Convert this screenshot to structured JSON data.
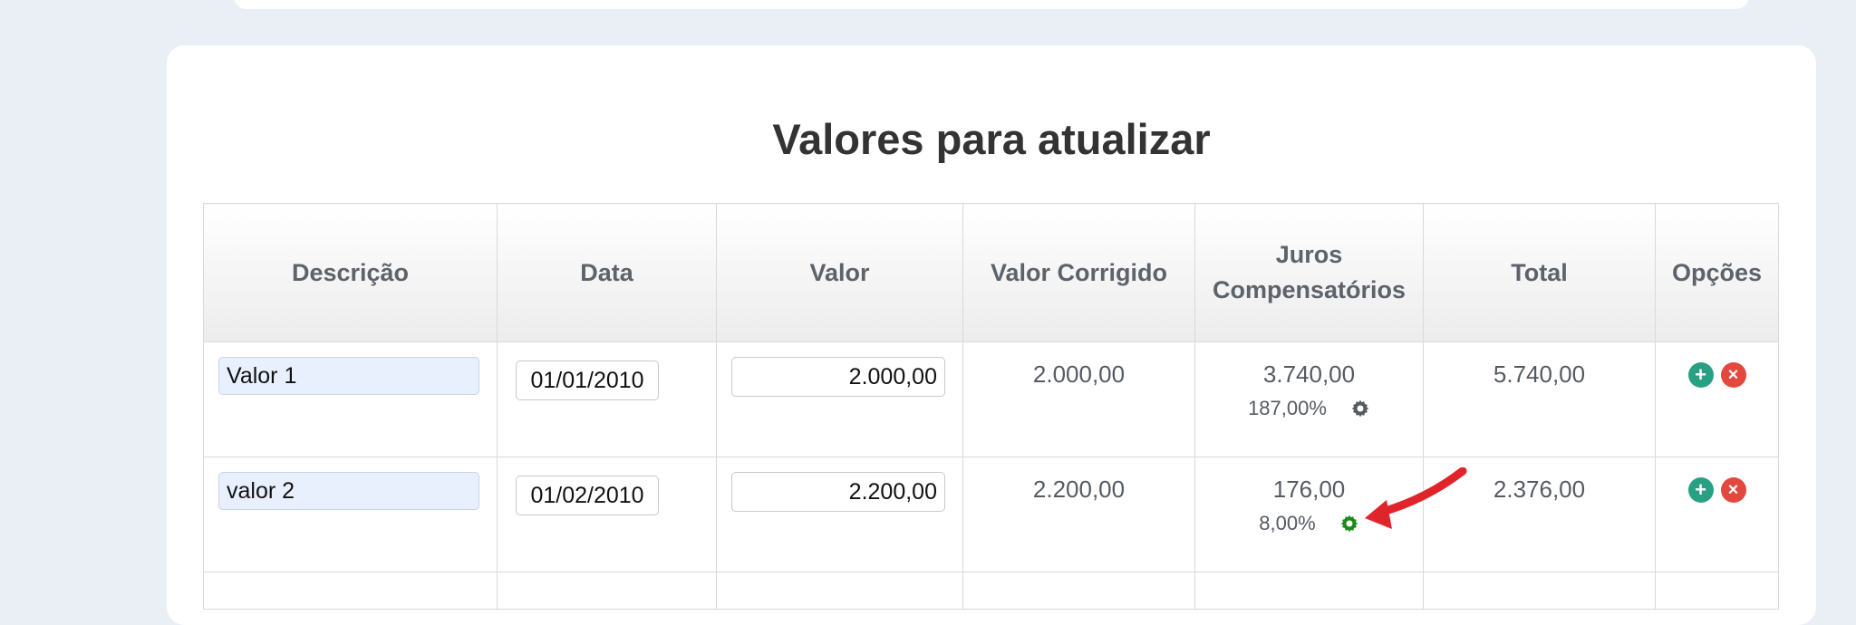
{
  "title": "Valores para atualizar",
  "columns": {
    "descricao": "Descrição",
    "data": "Data",
    "valor": "Valor",
    "valor_corrigido": "Valor Corrigido",
    "juros_line1": "Juros",
    "juros_line2": "Compensatórios",
    "total": "Total",
    "opcoes": "Opções"
  },
  "rows": [
    {
      "descricao": "Valor 1",
      "data": "01/01/2010",
      "valor": "2.000,00",
      "valor_corrigido": "2.000,00",
      "juros": "3.740,00",
      "juros_percent": "187,00%",
      "gear_color": "#555b63",
      "total": "5.740,00",
      "add_icon": "+",
      "remove_icon": "×"
    },
    {
      "descricao": "valor 2",
      "data": "01/02/2010",
      "valor": "2.200,00",
      "valor_corrigido": "2.200,00",
      "juros": "176,00",
      "juros_percent": "8,00%",
      "gear_color": "#1e8a1e",
      "total": "2.376,00",
      "add_icon": "+",
      "remove_icon": "×"
    }
  ],
  "colors": {
    "page_background": "#eaeef5",
    "card": "#ffffff",
    "add_button": "#27a083",
    "remove_button": "#e2483d",
    "annotation_arrow": "#e0242a"
  },
  "icons": {
    "gear": "gear-icon",
    "add": "plus-circle-icon",
    "remove": "close-circle-icon",
    "annotation": "red-arrow-annotation"
  }
}
